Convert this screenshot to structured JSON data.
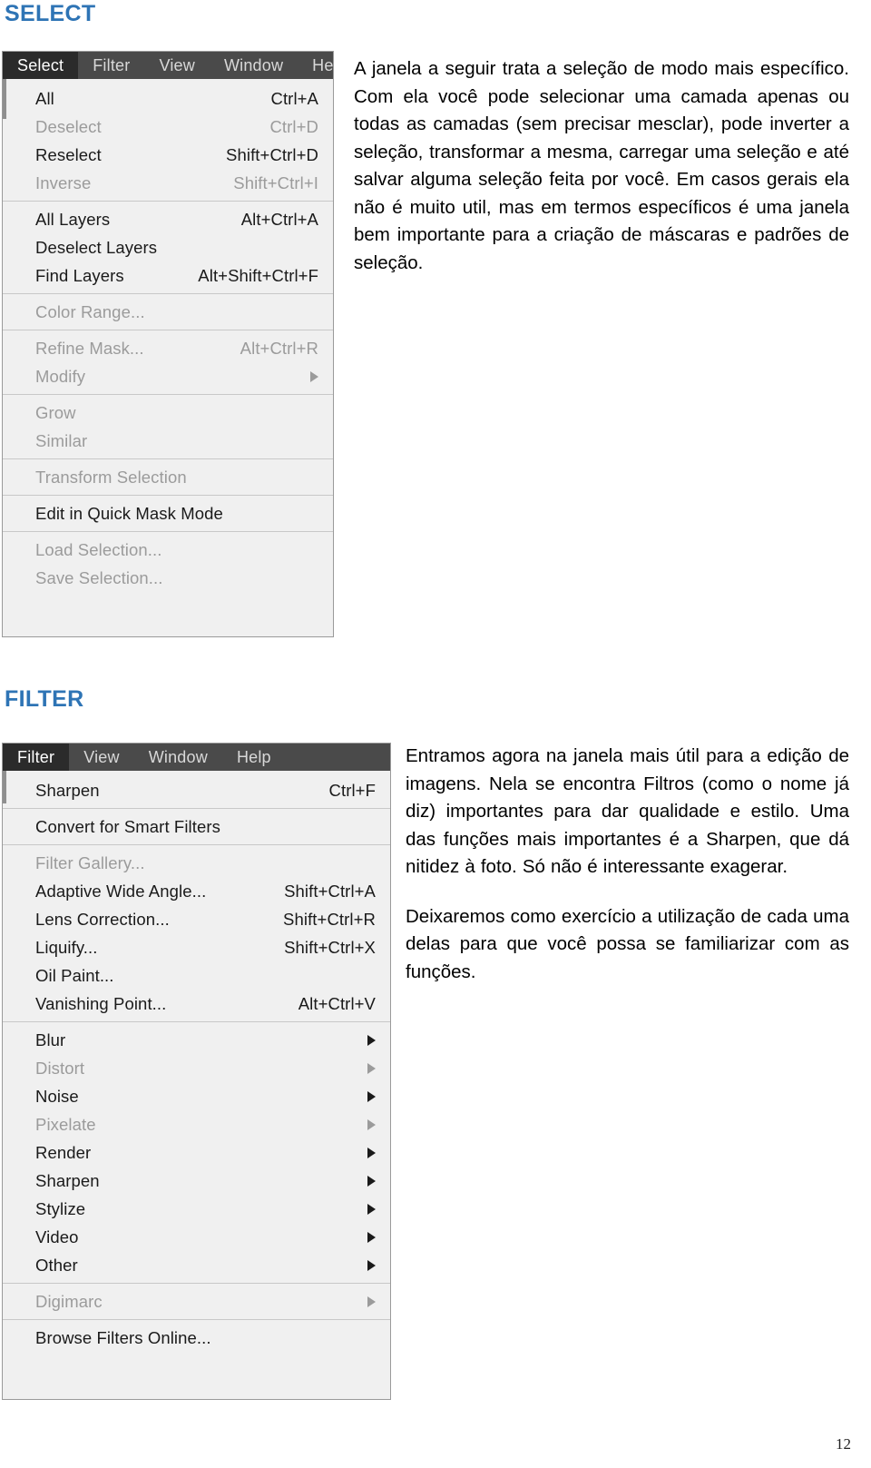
{
  "page": {
    "number": "12"
  },
  "sections": [
    {
      "heading": "SELECT",
      "paragraphs": [
        "A janela a seguir trata a seleção de modo mais específico. Com ela você pode selecionar uma camada apenas ou todas as camadas (sem precisar mesclar), pode inverter a seleção, transformar a mesma, carregar uma seleção e até salvar alguma seleção feita por você. Em casos gerais ela não é muito util, mas em termos específicos é uma janela bem importante para a criação de máscaras e padrões de seleção."
      ]
    },
    {
      "heading": "FILTER",
      "paragraphs": [
        "Entramos agora na janela mais útil para a edição de imagens. Nela se encontra Filtros (como o nome já diz) importantes para dar qualidade e estilo. Uma das funções mais importantes é a Sharpen, que dá nitidez à foto. Só não é interessante exagerar.",
        "Deixaremos como exercício a utilização de cada uma delas para que você possa se familiarizar com as funções."
      ]
    }
  ],
  "select_menu": {
    "menubar": [
      {
        "label": "Select",
        "active": true
      },
      {
        "label": "Filter",
        "active": false
      },
      {
        "label": "View",
        "active": false
      },
      {
        "label": "Window",
        "active": false
      },
      {
        "label": "Hel",
        "active": false
      }
    ],
    "groups": [
      {
        "items": [
          {
            "label": "All",
            "shortcut": "Ctrl+A",
            "disabled": false,
            "submenu": false
          },
          {
            "label": "Deselect",
            "shortcut": "Ctrl+D",
            "disabled": true,
            "submenu": false
          },
          {
            "label": "Reselect",
            "shortcut": "Shift+Ctrl+D",
            "disabled": false,
            "submenu": false
          },
          {
            "label": "Inverse",
            "shortcut": "Shift+Ctrl+I",
            "disabled": true,
            "submenu": false
          }
        ]
      },
      {
        "items": [
          {
            "label": "All Layers",
            "shortcut": "Alt+Ctrl+A",
            "disabled": false,
            "submenu": false
          },
          {
            "label": "Deselect Layers",
            "shortcut": "",
            "disabled": false,
            "submenu": false
          },
          {
            "label": "Find Layers",
            "shortcut": "Alt+Shift+Ctrl+F",
            "disabled": false,
            "submenu": false
          }
        ]
      },
      {
        "items": [
          {
            "label": "Color Range...",
            "shortcut": "",
            "disabled": true,
            "submenu": false
          }
        ]
      },
      {
        "items": [
          {
            "label": "Refine Mask...",
            "shortcut": "Alt+Ctrl+R",
            "disabled": true,
            "submenu": false
          },
          {
            "label": "Modify",
            "shortcut": "",
            "disabled": true,
            "submenu": true
          }
        ]
      },
      {
        "items": [
          {
            "label": "Grow",
            "shortcut": "",
            "disabled": true,
            "submenu": false
          },
          {
            "label": "Similar",
            "shortcut": "",
            "disabled": true,
            "submenu": false
          }
        ]
      },
      {
        "items": [
          {
            "label": "Transform Selection",
            "shortcut": "",
            "disabled": true,
            "submenu": false
          }
        ]
      },
      {
        "items": [
          {
            "label": "Edit in Quick Mask Mode",
            "shortcut": "",
            "disabled": false,
            "submenu": false
          }
        ]
      },
      {
        "items": [
          {
            "label": "Load Selection...",
            "shortcut": "",
            "disabled": true,
            "submenu": false
          },
          {
            "label": "Save Selection...",
            "shortcut": "",
            "disabled": true,
            "submenu": false
          }
        ]
      }
    ]
  },
  "filter_menu": {
    "menubar": [
      {
        "label": "Filter",
        "active": true
      },
      {
        "label": "View",
        "active": false
      },
      {
        "label": "Window",
        "active": false
      },
      {
        "label": "Help",
        "active": false
      }
    ],
    "groups": [
      {
        "items": [
          {
            "label": "Sharpen",
            "shortcut": "Ctrl+F",
            "disabled": false,
            "submenu": false
          }
        ]
      },
      {
        "items": [
          {
            "label": "Convert for Smart Filters",
            "shortcut": "",
            "disabled": false,
            "submenu": false
          }
        ]
      },
      {
        "items": [
          {
            "label": "Filter Gallery...",
            "shortcut": "",
            "disabled": true,
            "submenu": false
          },
          {
            "label": "Adaptive Wide Angle...",
            "shortcut": "Shift+Ctrl+A",
            "disabled": false,
            "submenu": false
          },
          {
            "label": "Lens Correction...",
            "shortcut": "Shift+Ctrl+R",
            "disabled": false,
            "submenu": false
          },
          {
            "label": "Liquify...",
            "shortcut": "Shift+Ctrl+X",
            "disabled": false,
            "submenu": false
          },
          {
            "label": "Oil Paint...",
            "shortcut": "",
            "disabled": false,
            "submenu": false
          },
          {
            "label": "Vanishing Point...",
            "shortcut": "Alt+Ctrl+V",
            "disabled": false,
            "submenu": false
          }
        ]
      },
      {
        "items": [
          {
            "label": "Blur",
            "shortcut": "",
            "disabled": false,
            "submenu": true
          },
          {
            "label": "Distort",
            "shortcut": "",
            "disabled": true,
            "submenu": true
          },
          {
            "label": "Noise",
            "shortcut": "",
            "disabled": false,
            "submenu": true
          },
          {
            "label": "Pixelate",
            "shortcut": "",
            "disabled": true,
            "submenu": true
          },
          {
            "label": "Render",
            "shortcut": "",
            "disabled": false,
            "submenu": true
          },
          {
            "label": "Sharpen",
            "shortcut": "",
            "disabled": false,
            "submenu": true
          },
          {
            "label": "Stylize",
            "shortcut": "",
            "disabled": false,
            "submenu": true
          },
          {
            "label": "Video",
            "shortcut": "",
            "disabled": false,
            "submenu": true
          },
          {
            "label": "Other",
            "shortcut": "",
            "disabled": false,
            "submenu": true
          }
        ]
      },
      {
        "items": [
          {
            "label": "Digimarc",
            "shortcut": "",
            "disabled": true,
            "submenu": true
          }
        ]
      },
      {
        "items": [
          {
            "label": "Browse Filters Online...",
            "shortcut": "",
            "disabled": false,
            "submenu": false
          }
        ]
      }
    ]
  },
  "colors": {
    "heading_blue": "#2E74B5",
    "menubar_background": "#4a4a4a",
    "menubar_active": "#2b2b2b",
    "menu_background": "#f0f0f0",
    "menu_disabled_text": "#9b9b9b"
  }
}
